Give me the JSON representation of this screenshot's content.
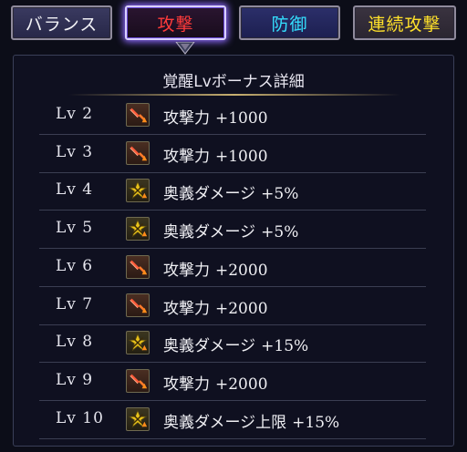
{
  "tabs": [
    {
      "label": "バランス",
      "key": "balance"
    },
    {
      "label": "攻撃",
      "key": "attack",
      "active": true
    },
    {
      "label": "防御",
      "key": "defense"
    },
    {
      "label": "連続攻撃",
      "key": "combo"
    }
  ],
  "panel": {
    "title": "覚醒Lvボーナス詳細"
  },
  "rows": [
    {
      "level": "Lv 2",
      "icon": "attack-up-icon",
      "label": "攻撃力",
      "value": "+1000"
    },
    {
      "level": "Lv 3",
      "icon": "attack-up-icon",
      "label": "攻撃力",
      "value": "+1000"
    },
    {
      "level": "Lv 4",
      "icon": "ougi-damage-icon",
      "label": "奥義ダメージ",
      "value": "+5%"
    },
    {
      "level": "Lv 5",
      "icon": "ougi-damage-icon",
      "label": "奥義ダメージ",
      "value": "+5%"
    },
    {
      "level": "Lv 6",
      "icon": "attack-up-icon",
      "label": "攻撃力",
      "value": "+2000"
    },
    {
      "level": "Lv 7",
      "icon": "attack-up-icon",
      "label": "攻撃力",
      "value": "+2000"
    },
    {
      "level": "Lv 8",
      "icon": "ougi-damage-icon",
      "label": "奥義ダメージ",
      "value": "+15%"
    },
    {
      "level": "Lv 9",
      "icon": "attack-up-icon",
      "label": "攻撃力",
      "value": "+2000"
    },
    {
      "level": "Lv 10",
      "icon": "ougi-damage-icon",
      "label": "奥義ダメージ上限",
      "value": "+15%"
    }
  ],
  "colors": {
    "tab_balance": "#f2f2f6",
    "tab_attack": "#ff3b3b",
    "tab_defense": "#34e0ff",
    "tab_combo": "#ffe12a"
  }
}
